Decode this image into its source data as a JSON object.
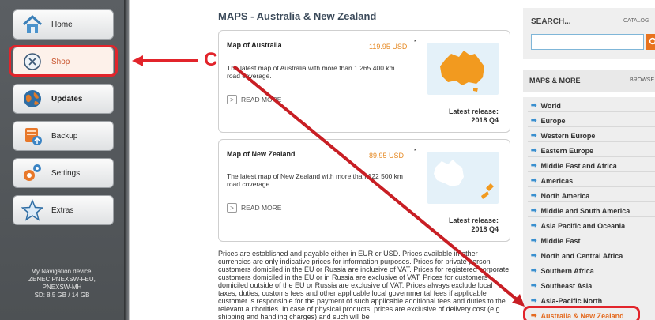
{
  "sidebar": {
    "items": [
      {
        "label": "Home",
        "icon": "home-icon"
      },
      {
        "label": "Shop",
        "icon": "shop-icon"
      },
      {
        "label": "Updates",
        "icon": "updates-globe-icon"
      },
      {
        "label": "Backup",
        "icon": "backup-icon"
      },
      {
        "label": "Settings",
        "icon": "settings-gear-icon"
      },
      {
        "label": "Extras",
        "icon": "star-icon"
      }
    ],
    "device_info": [
      "My Navigation device:",
      "ZENEC PNEXSW-FEU,",
      "PNEXSW-MH",
      "SD: 8.5 GB / 14 GB"
    ]
  },
  "main": {
    "title": "MAPS - Australia & New Zealand",
    "products": [
      {
        "title": "Map of Australia",
        "price": "119.95 USD",
        "asterisk": "*",
        "description": "The latest map of Australia with more than 1 265 400 km road coverage.",
        "read_more": "READ MORE",
        "release_label": "Latest release:",
        "release_value": "2018 Q4"
      },
      {
        "title": "Map of New Zealand",
        "price": "89.95 USD",
        "asterisk": "*",
        "description": "The latest map of New Zealand with more than 122 500 km road coverage.",
        "read_more": "READ MORE",
        "release_label": "Latest release:",
        "release_value": "2018 Q4"
      }
    ],
    "disclaimer": "Prices are established and payable either in EUR or USD. Prices available in other currencies are only indicative prices for information purposes. Prices for private person customers domiciled in the EU or Russia are inclusive of VAT. Prices for registered corporate customers domiciled in the EU or in Russia are exclusive of VAT. Prices for customers domiciled outside of the EU or Russia are exclusive of VAT. Prices always exclude local taxes, duties, customs fees and other applicable local governmental fees if applicable customer is responsible for the payment of such applicable additional fees and duties to the relevant authorities. In case of physical products, prices are exclusive of delivery cost (e.g. shipping and handling charges) and such will be"
  },
  "search": {
    "title": "SEARCH...",
    "catalog": "CATALOG"
  },
  "maps_more": {
    "title": "MAPS & MORE",
    "browse": "BROWSE",
    "items": [
      "World",
      "Europe",
      "Western Europe",
      "Eastern Europe",
      "Middle East and Africa",
      "Americas",
      "North America",
      "Middle and South America",
      "Asia Pacific and Oceania",
      "Middle East",
      "North and Central Africa",
      "Southern Africa",
      "Southeast Asia",
      "Asia-Pacific North",
      "Australia & New Zealand"
    ],
    "selected": "Australia & New Zealand"
  },
  "annotation": {
    "letter": "C"
  },
  "colors": {
    "accent": "#e46a1f",
    "highlight": "#e2242b",
    "link_arrow": "#3a8fcf"
  }
}
